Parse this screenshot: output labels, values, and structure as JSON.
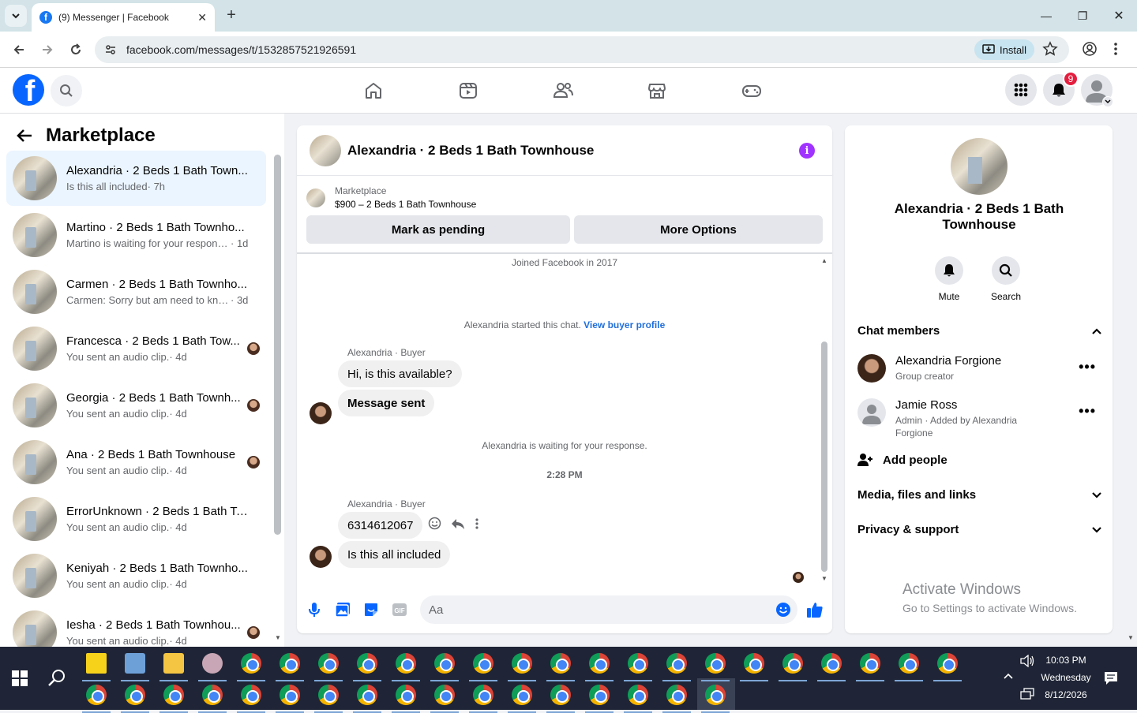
{
  "browser": {
    "tab_title": "(9) Messenger | Facebook",
    "url": "facebook.com/messages/t/1532857521926591",
    "install_label": "Install"
  },
  "topbar": {
    "notification_count": "9"
  },
  "sidebar": {
    "title": "Marketplace",
    "conversations": [
      {
        "name": "Alexandria · 2 Beds 1 Bath Town...",
        "snippet": "Is this all included",
        "time": "· 7h",
        "active": true
      },
      {
        "name": "Martino · 2 Beds 1 Bath Townho...",
        "snippet": "Martino is waiting for your response.",
        "time": "· 1d"
      },
      {
        "name": "Carmen · 2 Beds 1 Bath Townho...",
        "snippet": "Carmen: Sorry but am need to kno...",
        "time": "· 3d"
      },
      {
        "name": "Francesca · 2 Beds 1 Bath Tow...",
        "snippet": "You sent an audio clip.",
        "time": "· 4d"
      },
      {
        "name": "Georgia · 2 Beds 1 Bath Townh...",
        "snippet": "You sent an audio clip.",
        "time": "· 4d"
      },
      {
        "name": "Ana · 2 Beds 1 Bath Townhouse",
        "snippet": "You sent an audio clip.",
        "time": "· 4d"
      },
      {
        "name": "ErrorUnknown · 2 Beds 1 Bath To...",
        "snippet": "You sent an audio clip.",
        "time": "· 4d"
      },
      {
        "name": "Keniyah · 2 Beds 1 Bath Townho...",
        "snippet": "You sent an audio clip.",
        "time": "· 4d"
      },
      {
        "name": "Iesha · 2 Beds 1 Bath Townhou...",
        "snippet": "You sent an audio clip.",
        "time": "· 4d"
      }
    ]
  },
  "chat": {
    "title": "Alexandria · 2 Beds 1 Bath Townhouse",
    "listing_source": "Marketplace",
    "listing_title": "$900 – 2 Beds 1 Bath Townhouse",
    "mark_pending": "Mark as pending",
    "more_options": "More Options",
    "joined": "Joined Facebook in 2017",
    "started_text": "Alexandria started this chat.",
    "view_buyer": "View buyer profile",
    "sender_label": "Alexandria · Buyer",
    "msg1": "Hi, is this available?",
    "msg2": "Message sent",
    "waiting": "Alexandria is waiting for your response.",
    "time": "2:28 PM",
    "msg3": "6314612067",
    "msg4": "Is this all included",
    "composer_placeholder": "Aa"
  },
  "right": {
    "name": "Alexandria · 2 Beds 1 Bath Townhouse",
    "mute": "Mute",
    "search": "Search",
    "chat_members": "Chat members",
    "members": [
      {
        "name": "Alexandria Forgione",
        "sub": "Group creator"
      },
      {
        "name": "Jamie Ross",
        "sub": "Admin · Added by Alexandria Forgione"
      }
    ],
    "add_people": "Add people",
    "media": "Media, files and links",
    "privacy": "Privacy & support",
    "activate_title": "Activate Windows",
    "activate_sub": "Go to Settings to activate Windows."
  },
  "taskbar": {
    "time": "10:03 PM",
    "day": "Wednesday",
    "date": "8/12/2026"
  }
}
